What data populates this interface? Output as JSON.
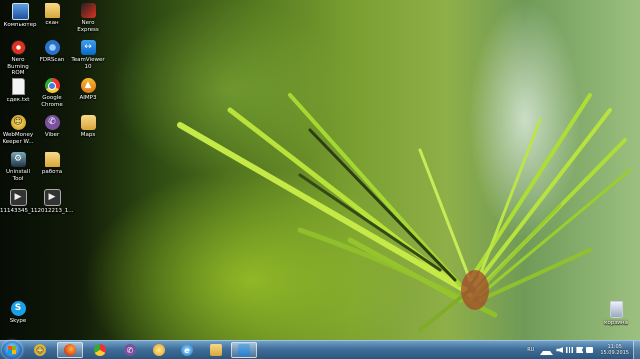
{
  "desktop": {
    "icons": [
      {
        "label": "Компьютер",
        "icon": "computer-icon"
      },
      {
        "label": "скан",
        "icon": "folder-icon"
      },
      {
        "label": "Nero Express",
        "icon": "nero-express-icon"
      },
      {
        "label": "Nero Burning ROM",
        "icon": "nero-icon"
      },
      {
        "label": "FDRScan",
        "icon": "fdrscan-icon"
      },
      {
        "label": "TeamViewer 10",
        "icon": "teamviewer-icon"
      },
      {
        "label": "сдек.txt",
        "icon": "text-file-icon"
      },
      {
        "label": "Google Chrome",
        "icon": "chrome-icon"
      },
      {
        "label": "AIMP3",
        "icon": "aimp-icon"
      },
      {
        "label": "WebMoney Keeper W...",
        "icon": "webmoney-icon"
      },
      {
        "label": "Viber",
        "icon": "viber-icon"
      },
      {
        "label": "Maps",
        "icon": "folder-icon"
      },
      {
        "label": "Uninstall Tool",
        "icon": "uninstall-icon"
      },
      {
        "label": "работа",
        "icon": "folder-icon"
      },
      {
        "label": "11143345_1...",
        "icon": "video-file-icon"
      },
      {
        "label": "12012213_1...",
        "icon": "video-file-icon"
      },
      {
        "label": "Skype",
        "icon": "skype-icon"
      },
      {
        "label": "корзина",
        "icon": "recycle-bin-icon"
      }
    ]
  },
  "taskbar": {
    "pinned": [
      {
        "name": "webmoney",
        "icon": "webmoney-icon"
      },
      {
        "name": "firefox",
        "icon": "firefox-icon",
        "active": true
      },
      {
        "name": "chrome",
        "icon": "chrome-icon"
      },
      {
        "name": "viber",
        "icon": "viber-icon"
      },
      {
        "name": "paint",
        "icon": "paint-icon"
      },
      {
        "name": "internet-explorer",
        "icon": "internet-explorer-icon"
      },
      {
        "name": "explorer",
        "icon": "folder-icon"
      },
      {
        "name": "teamviewer",
        "icon": "teamviewer-icon",
        "active": true
      }
    ],
    "tray": {
      "language": "RU",
      "time": "11:05",
      "date": "15.09.2015"
    }
  }
}
